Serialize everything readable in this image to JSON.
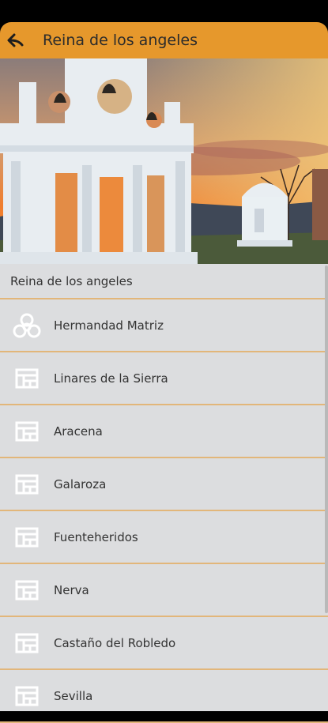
{
  "header": {
    "title": "Reina de los angeles"
  },
  "section": {
    "title": "Reina de los angeles"
  },
  "items": [
    {
      "label": "Hermandad Matriz",
      "icon": "trinity-knot-icon"
    },
    {
      "label": "Linares de la Sierra",
      "icon": "building-grid-icon"
    },
    {
      "label": "Aracena",
      "icon": "building-grid-icon"
    },
    {
      "label": "Galaroza",
      "icon": "building-grid-icon"
    },
    {
      "label": "Fuenteheridos",
      "icon": "building-grid-icon"
    },
    {
      "label": "Nerva",
      "icon": "building-grid-icon"
    },
    {
      "label": "Castaño del Robledo",
      "icon": "building-grid-icon"
    },
    {
      "label": "Sevilla",
      "icon": "building-grid-icon"
    }
  ],
  "colors": {
    "accent": "#e6982c",
    "divider": "#e2b67a",
    "list_bg": "#dcdddf"
  }
}
